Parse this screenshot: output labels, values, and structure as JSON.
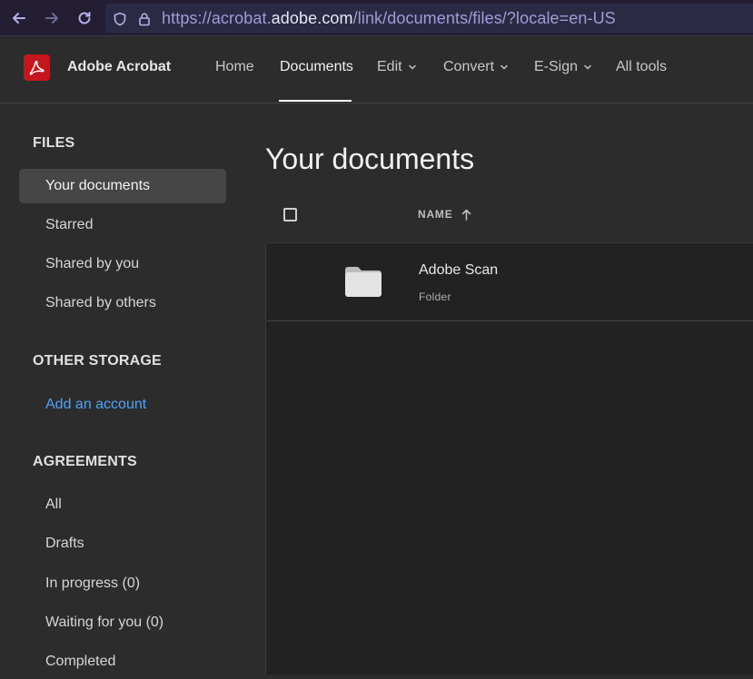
{
  "browser": {
    "url_prefix": "https://acrobat.",
    "url_host": "adobe.com",
    "url_suffix": "/link/documents/files/?locale=en-US"
  },
  "header": {
    "app_name": "Adobe Acrobat",
    "nav": [
      {
        "label": "Home"
      },
      {
        "label": "Documents"
      },
      {
        "label": "Edit"
      },
      {
        "label": "Convert"
      },
      {
        "label": "E-Sign"
      },
      {
        "label": "All tools"
      }
    ],
    "active_nav": "Documents"
  },
  "sidebar": {
    "files_heading": "FILES",
    "files_items": [
      {
        "label": "Your documents"
      },
      {
        "label": "Starred"
      },
      {
        "label": "Shared by you"
      },
      {
        "label": "Shared by others"
      }
    ],
    "other_storage_heading": "OTHER STORAGE",
    "add_account_label": "Add an account",
    "agreements_heading": "AGREEMENTS",
    "agreements_items": [
      {
        "label": "All"
      },
      {
        "label": "Drafts"
      },
      {
        "label": "In progress (0)"
      },
      {
        "label": "Waiting for you (0)"
      },
      {
        "label": "Completed"
      }
    ]
  },
  "main": {
    "title": "Your documents",
    "column_name": "NAME",
    "rows": [
      {
        "name": "Adobe Scan",
        "type": "Folder"
      }
    ]
  },
  "colors": {
    "accent_link": "#4da3ff",
    "logo_red": "#c5161d",
    "background": "#2c2c2c"
  },
  "icons": {
    "back": "arrow-left-icon",
    "forward": "arrow-right-icon",
    "reload": "reload-icon",
    "shield": "shield-icon",
    "lock": "lock-icon",
    "sort": "arrow-up-icon",
    "folder": "folder-icon"
  }
}
